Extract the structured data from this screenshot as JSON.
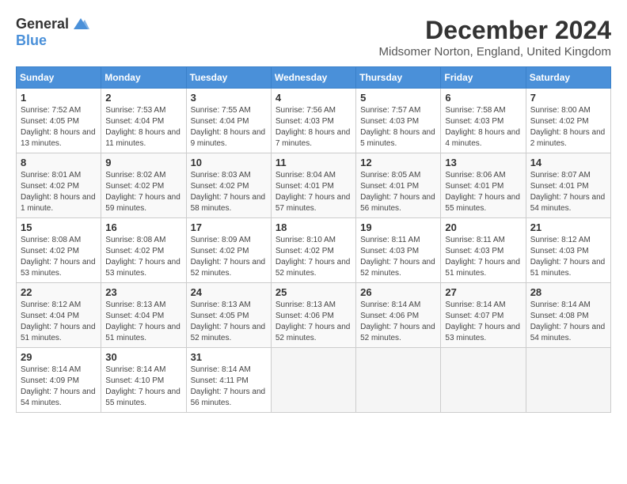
{
  "header": {
    "logo_general": "General",
    "logo_blue": "Blue",
    "month_title": "December 2024",
    "location": "Midsomer Norton, England, United Kingdom"
  },
  "calendar": {
    "days_of_week": [
      "Sunday",
      "Monday",
      "Tuesday",
      "Wednesday",
      "Thursday",
      "Friday",
      "Saturday"
    ],
    "weeks": [
      [
        null,
        {
          "day": "2",
          "sunrise": "Sunrise: 7:53 AM",
          "sunset": "Sunset: 4:04 PM",
          "daylight": "Daylight: 8 hours and 11 minutes."
        },
        {
          "day": "3",
          "sunrise": "Sunrise: 7:55 AM",
          "sunset": "Sunset: 4:04 PM",
          "daylight": "Daylight: 8 hours and 9 minutes."
        },
        {
          "day": "4",
          "sunrise": "Sunrise: 7:56 AM",
          "sunset": "Sunset: 4:03 PM",
          "daylight": "Daylight: 8 hours and 7 minutes."
        },
        {
          "day": "5",
          "sunrise": "Sunrise: 7:57 AM",
          "sunset": "Sunset: 4:03 PM",
          "daylight": "Daylight: 8 hours and 5 minutes."
        },
        {
          "day": "6",
          "sunrise": "Sunrise: 7:58 AM",
          "sunset": "Sunset: 4:03 PM",
          "daylight": "Daylight: 8 hours and 4 minutes."
        },
        {
          "day": "7",
          "sunrise": "Sunrise: 8:00 AM",
          "sunset": "Sunset: 4:02 PM",
          "daylight": "Daylight: 8 hours and 2 minutes."
        }
      ],
      [
        {
          "day": "1",
          "sunrise": "Sunrise: 7:52 AM",
          "sunset": "Sunset: 4:05 PM",
          "daylight": "Daylight: 8 hours and 13 minutes."
        },
        null,
        null,
        null,
        null,
        null,
        null
      ],
      [
        {
          "day": "8",
          "sunrise": "Sunrise: 8:01 AM",
          "sunset": "Sunset: 4:02 PM",
          "daylight": "Daylight: 8 hours and 1 minute."
        },
        {
          "day": "9",
          "sunrise": "Sunrise: 8:02 AM",
          "sunset": "Sunset: 4:02 PM",
          "daylight": "Daylight: 7 hours and 59 minutes."
        },
        {
          "day": "10",
          "sunrise": "Sunrise: 8:03 AM",
          "sunset": "Sunset: 4:02 PM",
          "daylight": "Daylight: 7 hours and 58 minutes."
        },
        {
          "day": "11",
          "sunrise": "Sunrise: 8:04 AM",
          "sunset": "Sunset: 4:01 PM",
          "daylight": "Daylight: 7 hours and 57 minutes."
        },
        {
          "day": "12",
          "sunrise": "Sunrise: 8:05 AM",
          "sunset": "Sunset: 4:01 PM",
          "daylight": "Daylight: 7 hours and 56 minutes."
        },
        {
          "day": "13",
          "sunrise": "Sunrise: 8:06 AM",
          "sunset": "Sunset: 4:01 PM",
          "daylight": "Daylight: 7 hours and 55 minutes."
        },
        {
          "day": "14",
          "sunrise": "Sunrise: 8:07 AM",
          "sunset": "Sunset: 4:01 PM",
          "daylight": "Daylight: 7 hours and 54 minutes."
        }
      ],
      [
        {
          "day": "15",
          "sunrise": "Sunrise: 8:08 AM",
          "sunset": "Sunset: 4:02 PM",
          "daylight": "Daylight: 7 hours and 53 minutes."
        },
        {
          "day": "16",
          "sunrise": "Sunrise: 8:08 AM",
          "sunset": "Sunset: 4:02 PM",
          "daylight": "Daylight: 7 hours and 53 minutes."
        },
        {
          "day": "17",
          "sunrise": "Sunrise: 8:09 AM",
          "sunset": "Sunset: 4:02 PM",
          "daylight": "Daylight: 7 hours and 52 minutes."
        },
        {
          "day": "18",
          "sunrise": "Sunrise: 8:10 AM",
          "sunset": "Sunset: 4:02 PM",
          "daylight": "Daylight: 7 hours and 52 minutes."
        },
        {
          "day": "19",
          "sunrise": "Sunrise: 8:11 AM",
          "sunset": "Sunset: 4:03 PM",
          "daylight": "Daylight: 7 hours and 52 minutes."
        },
        {
          "day": "20",
          "sunrise": "Sunrise: 8:11 AM",
          "sunset": "Sunset: 4:03 PM",
          "daylight": "Daylight: 7 hours and 51 minutes."
        },
        {
          "day": "21",
          "sunrise": "Sunrise: 8:12 AM",
          "sunset": "Sunset: 4:03 PM",
          "daylight": "Daylight: 7 hours and 51 minutes."
        }
      ],
      [
        {
          "day": "22",
          "sunrise": "Sunrise: 8:12 AM",
          "sunset": "Sunset: 4:04 PM",
          "daylight": "Daylight: 7 hours and 51 minutes."
        },
        {
          "day": "23",
          "sunrise": "Sunrise: 8:13 AM",
          "sunset": "Sunset: 4:04 PM",
          "daylight": "Daylight: 7 hours and 51 minutes."
        },
        {
          "day": "24",
          "sunrise": "Sunrise: 8:13 AM",
          "sunset": "Sunset: 4:05 PM",
          "daylight": "Daylight: 7 hours and 52 minutes."
        },
        {
          "day": "25",
          "sunrise": "Sunrise: 8:13 AM",
          "sunset": "Sunset: 4:06 PM",
          "daylight": "Daylight: 7 hours and 52 minutes."
        },
        {
          "day": "26",
          "sunrise": "Sunrise: 8:14 AM",
          "sunset": "Sunset: 4:06 PM",
          "daylight": "Daylight: 7 hours and 52 minutes."
        },
        {
          "day": "27",
          "sunrise": "Sunrise: 8:14 AM",
          "sunset": "Sunset: 4:07 PM",
          "daylight": "Daylight: 7 hours and 53 minutes."
        },
        {
          "day": "28",
          "sunrise": "Sunrise: 8:14 AM",
          "sunset": "Sunset: 4:08 PM",
          "daylight": "Daylight: 7 hours and 54 minutes."
        }
      ],
      [
        {
          "day": "29",
          "sunrise": "Sunrise: 8:14 AM",
          "sunset": "Sunset: 4:09 PM",
          "daylight": "Daylight: 7 hours and 54 minutes."
        },
        {
          "day": "30",
          "sunrise": "Sunrise: 8:14 AM",
          "sunset": "Sunset: 4:10 PM",
          "daylight": "Daylight: 7 hours and 55 minutes."
        },
        {
          "day": "31",
          "sunrise": "Sunrise: 8:14 AM",
          "sunset": "Sunset: 4:11 PM",
          "daylight": "Daylight: 7 hours and 56 minutes."
        },
        null,
        null,
        null,
        null
      ]
    ]
  }
}
